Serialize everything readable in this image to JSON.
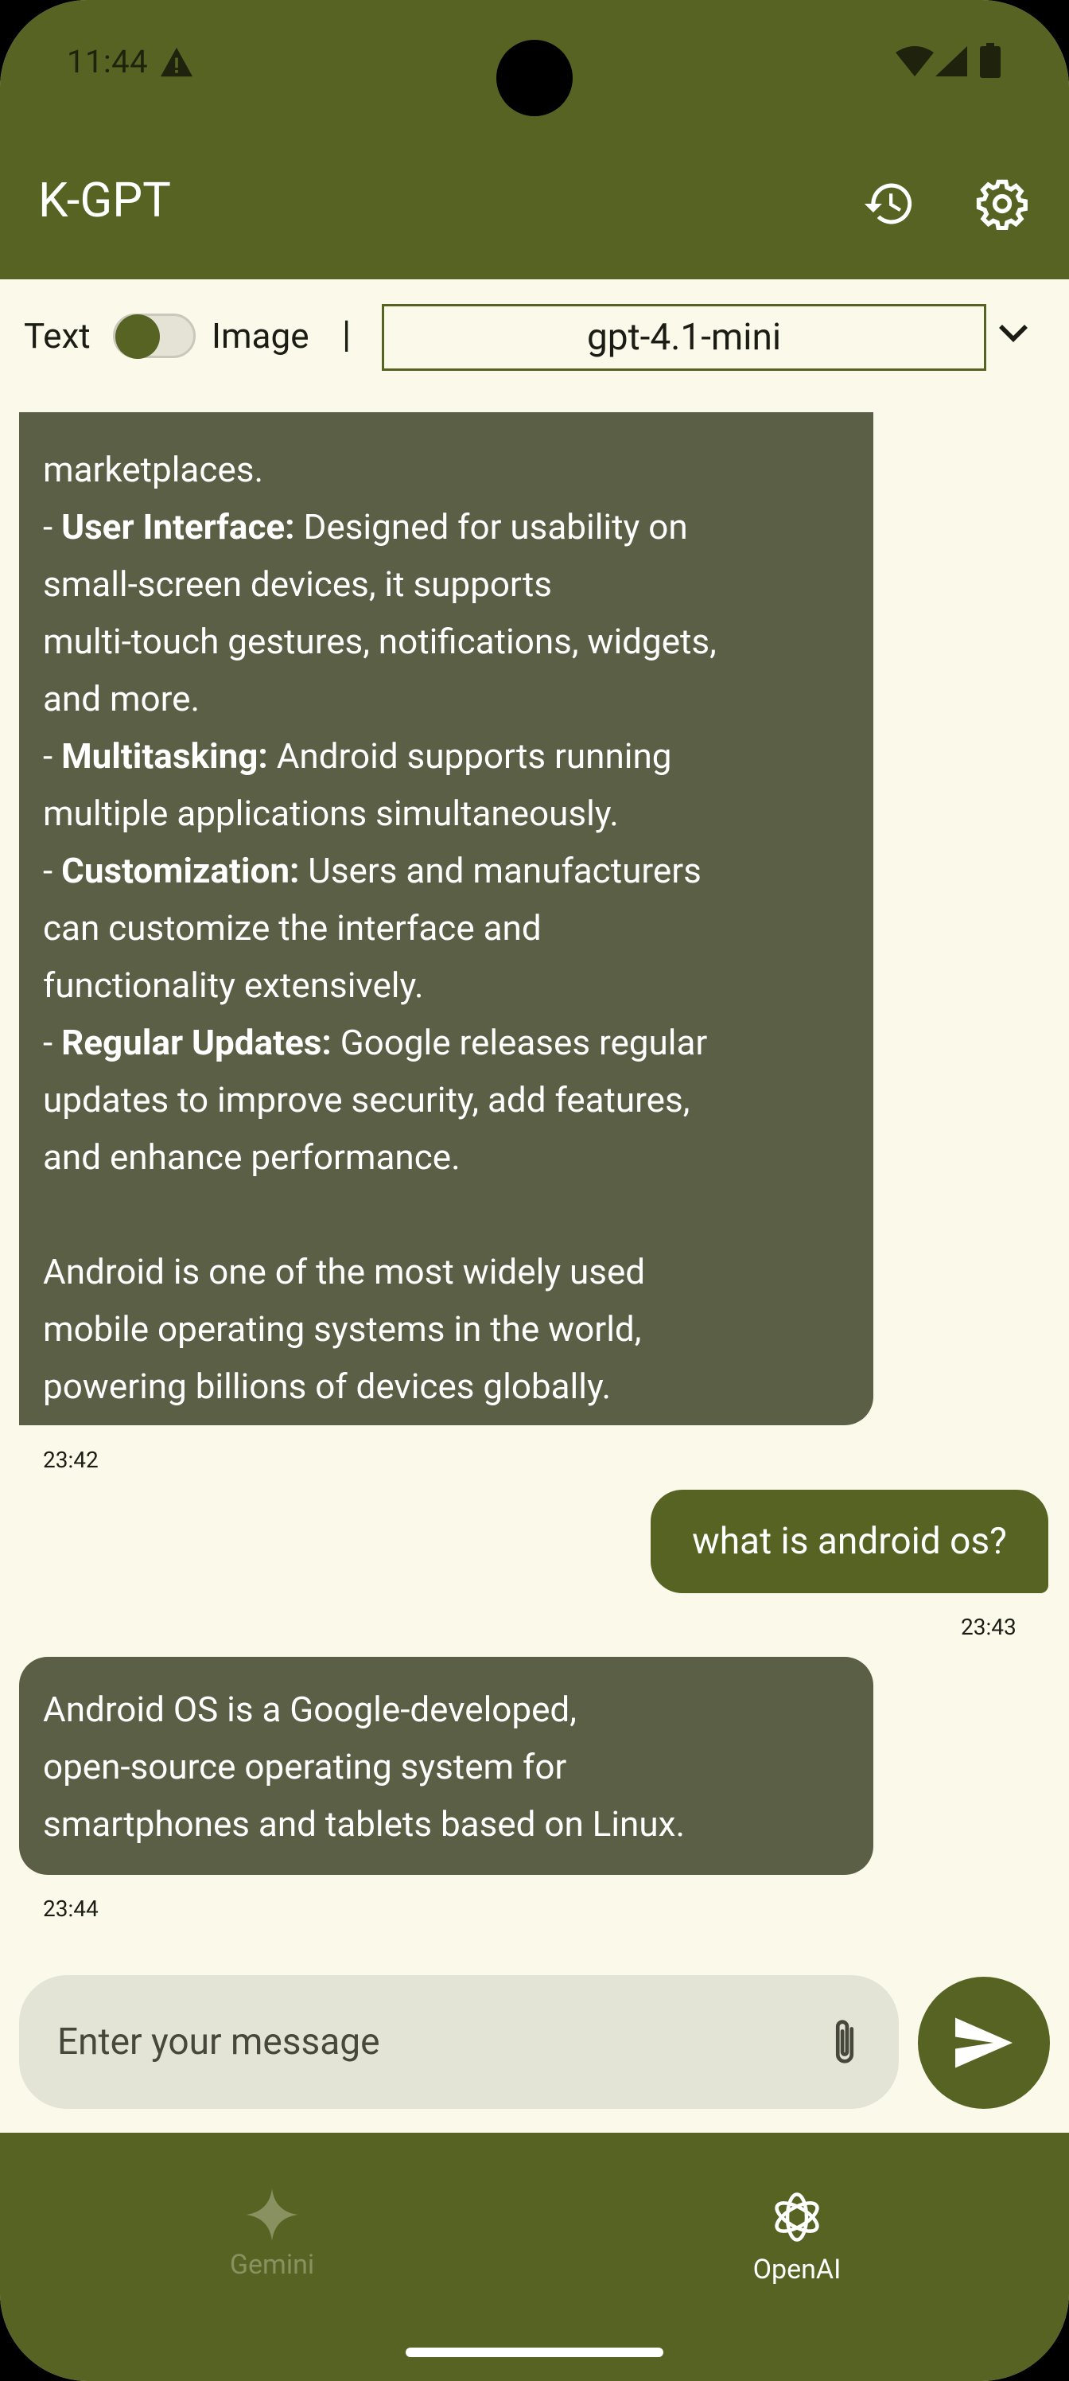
{
  "status": {
    "time": "11:44",
    "warn_icon": "warning-icon",
    "icons": [
      "wifi-icon",
      "cell-signal-icon",
      "battery-icon"
    ]
  },
  "appbar": {
    "title": "K-GPT",
    "history_icon": "history-icon",
    "settings_icon": "settings-icon"
  },
  "mode": {
    "text_label": "Text",
    "image_label": "Image",
    "separator": "|",
    "model": "gpt-4.1-mini"
  },
  "chat": {
    "ai1_lines": [
      {
        "pre": "",
        "bold": "",
        "post": "marketplaces."
      },
      {
        "pre": "- ",
        "bold": "User Interface:",
        "post": " Designed for usability on"
      },
      {
        "pre": "",
        "bold": "",
        "post": "small-screen devices, it supports"
      },
      {
        "pre": "",
        "bold": "",
        "post": "multi-touch gestures, notifications, widgets,"
      },
      {
        "pre": "",
        "bold": "",
        "post": "and more."
      },
      {
        "pre": "- ",
        "bold": "Multitasking:",
        "post": " Android supports running"
      },
      {
        "pre": "",
        "bold": "",
        "post": "multiple applications simultaneously."
      },
      {
        "pre": "- ",
        "bold": "Customization:",
        "post": " Users and manufacturers"
      },
      {
        "pre": "",
        "bold": "",
        "post": "can customize the interface and"
      },
      {
        "pre": "",
        "bold": "",
        "post": "functionality extensively."
      },
      {
        "pre": "- ",
        "bold": "Regular Updates:",
        "post": " Google releases regular"
      },
      {
        "pre": "",
        "bold": "",
        "post": "updates to improve security, add features,"
      },
      {
        "pre": "",
        "bold": "",
        "post": "and enhance performance."
      },
      {
        "pre": "",
        "bold": "",
        "post": ""
      },
      {
        "pre": "",
        "bold": "",
        "post": "Android is one of the most widely used"
      },
      {
        "pre": "",
        "bold": "",
        "post": "mobile operating systems in the world,"
      },
      {
        "pre": "",
        "bold": "",
        "post": "powering billions of devices globally."
      }
    ],
    "ai1_time": "23:42",
    "user_msg": "what is android os?",
    "user_time": "23:43",
    "ai2_lines": [
      "Android OS is a Google-developed,",
      "open-source operating system for",
      "smartphones and tablets based on Linux."
    ],
    "ai2_time": "23:44"
  },
  "input": {
    "placeholder": "Enter your message",
    "attach_icon": "paperclip-icon",
    "send_icon": "send-icon"
  },
  "nav": {
    "gemini": "Gemini",
    "openai": "OpenAI",
    "active": "OpenAI"
  },
  "colors": {
    "primary": "#566323",
    "bubble_ai": "#5A5F45",
    "background": "#FBF9EA",
    "input_bg": "#E4E4D6"
  }
}
